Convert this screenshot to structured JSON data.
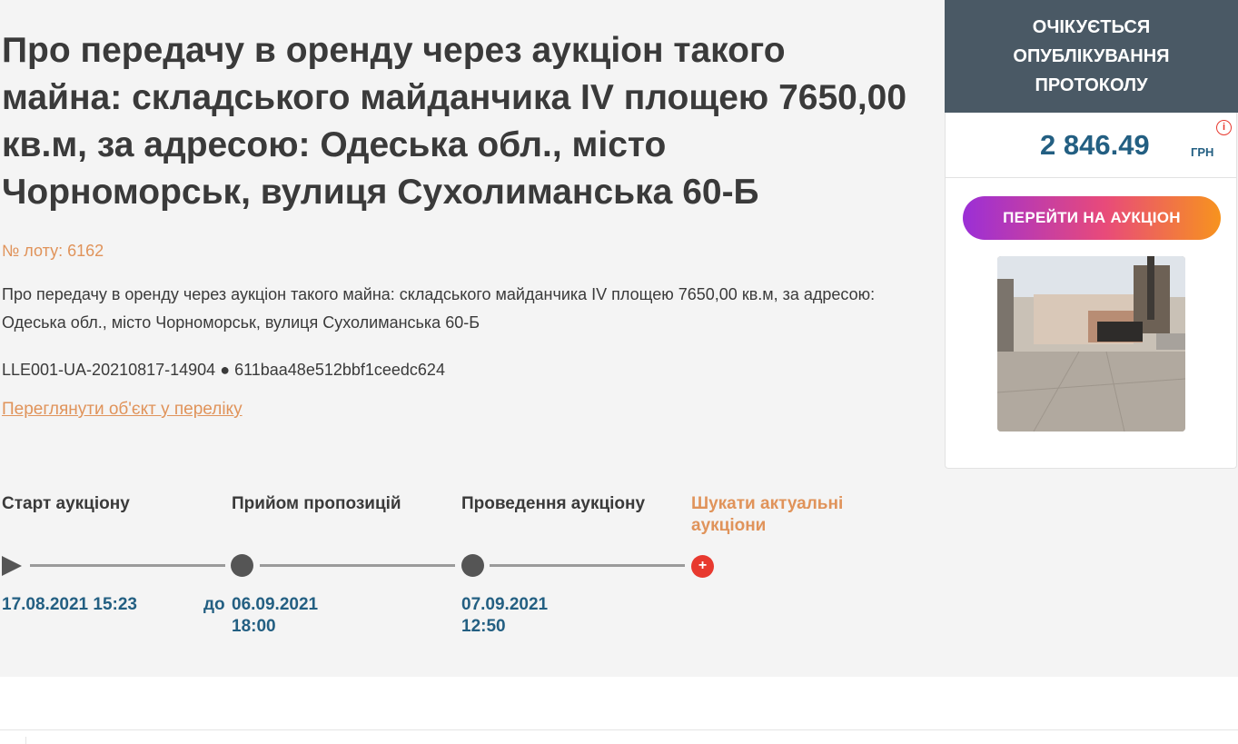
{
  "lot": {
    "title": "Про передачу в оренду через аукціон такого майна: складського майданчика IV площею 7650,00 кв.м, за адресою: Одеська обл., місто Чорноморськ, вулиця Сухолиманська 60-Б",
    "number_label": "№ лоту: 6162",
    "description": "Про передачу в оренду через аукціон такого майна: складського майданчика IV площею 7650,00 кв.м, за адресою: Одеська обл., місто Чорноморськ, вулиця Сухолиманська 60-Б",
    "auction_id": "LLE001-UA-20210817-14904",
    "separator": "●",
    "hash_id": "611baa48e512bbf1ceedc624",
    "view_link": "Переглянути об'єкт у переліку"
  },
  "timeline": {
    "steps": [
      {
        "label": "Старт аукціону",
        "date": "17.08.2021 15:23"
      },
      {
        "label": "Прийом пропозицій",
        "date_prefix": "до",
        "date": "06.09.2021 18:00"
      },
      {
        "label": "Проведення аукціону",
        "date": "07.09.2021 12:50"
      }
    ],
    "search_label": "Шукати актуальні аукціони",
    "plus_symbol": "+"
  },
  "sidebar": {
    "status": "ОЧІКУЄТЬСЯ ОПУБЛІКУВАННЯ ПРОТОКОЛУ",
    "price": "2 846.49",
    "currency": "ГРН",
    "info_symbol": "i",
    "auction_button": "ПЕРЕЙТИ НА АУКЦІОН"
  },
  "colors": {
    "accent_orange": "#e0935a",
    "status_bg": "#4a5965",
    "price_blue": "#235f82",
    "marker_red": "#e8392f"
  }
}
